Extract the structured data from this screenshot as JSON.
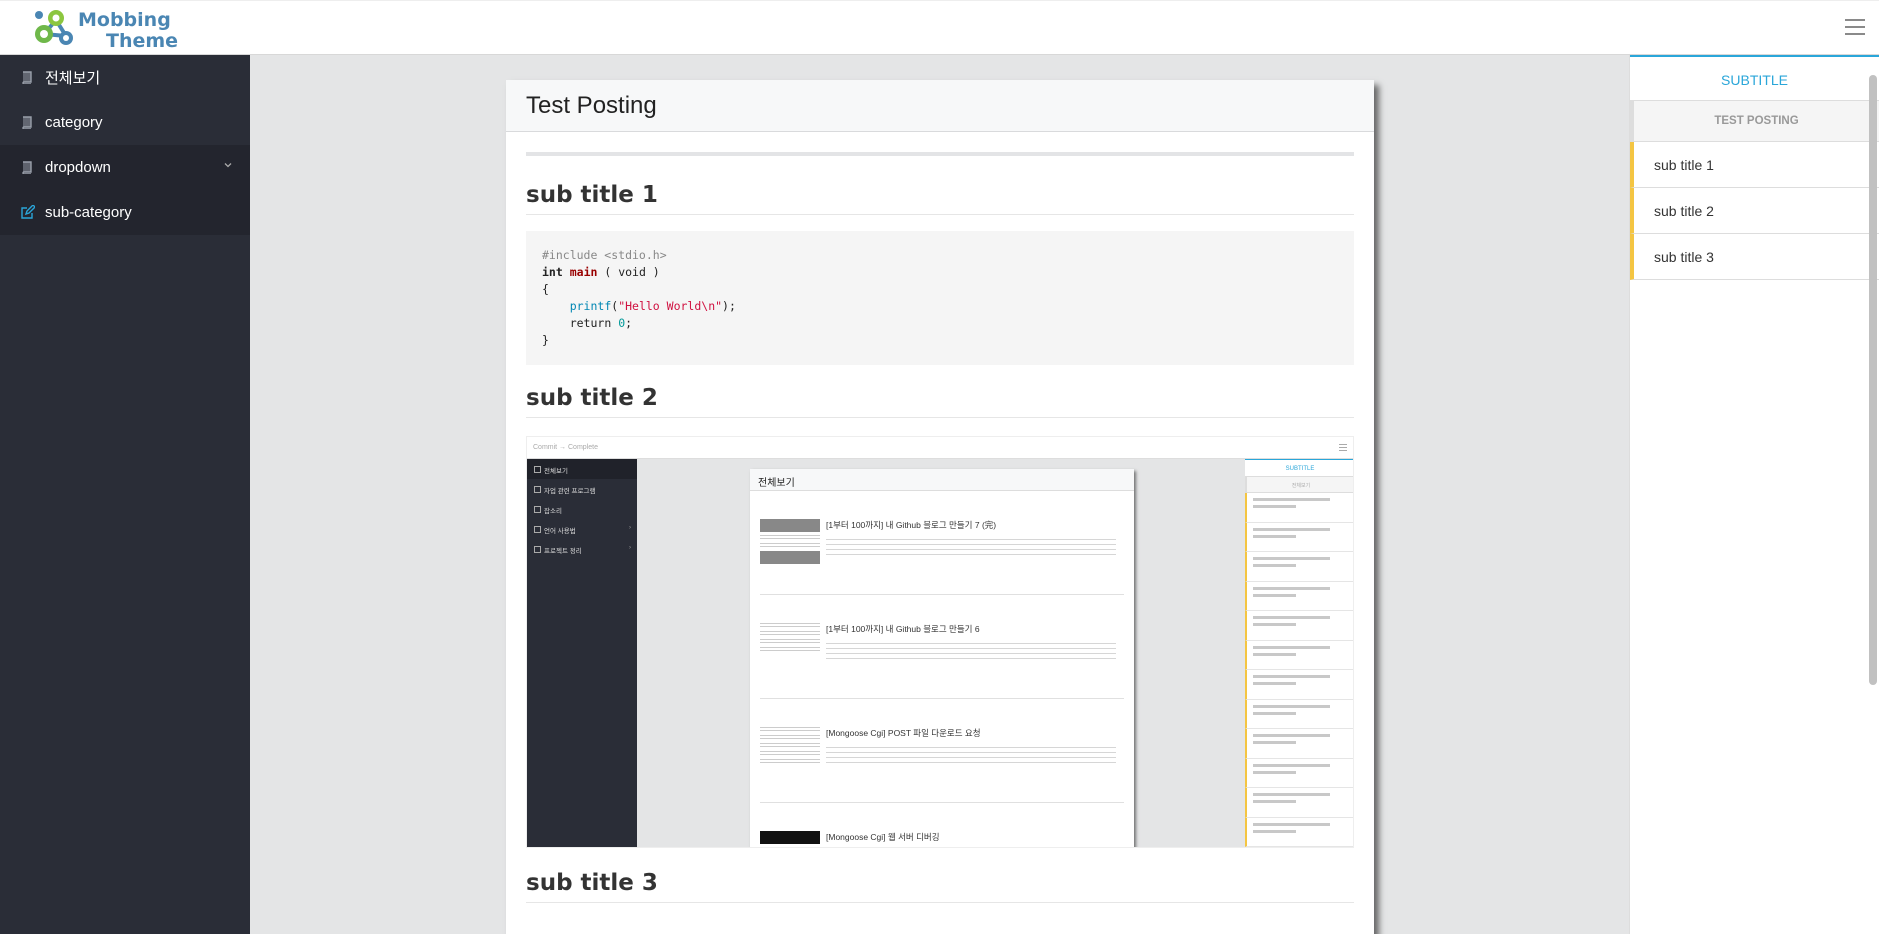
{
  "header": {
    "logo_line1": "Mobbing",
    "logo_line2": "Theme",
    "logo_icon": "network-nodes-logo",
    "menu_icon": "hamburger-icon"
  },
  "sidebar": {
    "items": [
      {
        "label": "전체보기",
        "icon": "book-icon"
      },
      {
        "label": "category",
        "icon": "book-icon"
      },
      {
        "label": "dropdown",
        "icon": "book-icon"
      },
      {
        "label": "sub-category",
        "icon": "edit-icon"
      }
    ]
  },
  "post": {
    "title": "Test Posting",
    "sub1": "sub title 1",
    "sub2": "sub title 2",
    "sub3": "sub title 3",
    "code": {
      "line1": "#include <stdio.h>",
      "int": "int",
      "main": "main",
      "void_sig": " ( void )",
      "brace_open": "{",
      "printf": "printf",
      "str": "\"Hello World\\n\"",
      "return": "return",
      "zero": "0",
      "brace_close": "}"
    }
  },
  "screenshot": {
    "breadcrumb": "Commit → Complete",
    "side_items": [
      "전체보기",
      "자업 관련 프로그램",
      "잡소리",
      "언어 사용법",
      "프로젝트 정리"
    ],
    "panel_title": "전체보기",
    "entries": [
      "[1부터 100까지] 내 Github 블로그 만들기 7 (完)",
      "[1부터 100까지] 내 Github 블로그 만들기 6",
      "[Mongoose Cgi] POST 파일 다운로드 요청",
      "[Mongoose Cgi] 웹 서버 디버깅"
    ],
    "toc_subtitle": "SUBTITLE",
    "toc_head": "전체보기"
  },
  "toc": {
    "subtitle": "SUBTITLE",
    "heading": "TEST POSTING",
    "items": [
      "sub title 1",
      "sub title 2",
      "sub title 3"
    ]
  },
  "colors": {
    "accent": "#2aa6d9",
    "marker": "#f4c542",
    "sidebar": "#2a2d37"
  }
}
